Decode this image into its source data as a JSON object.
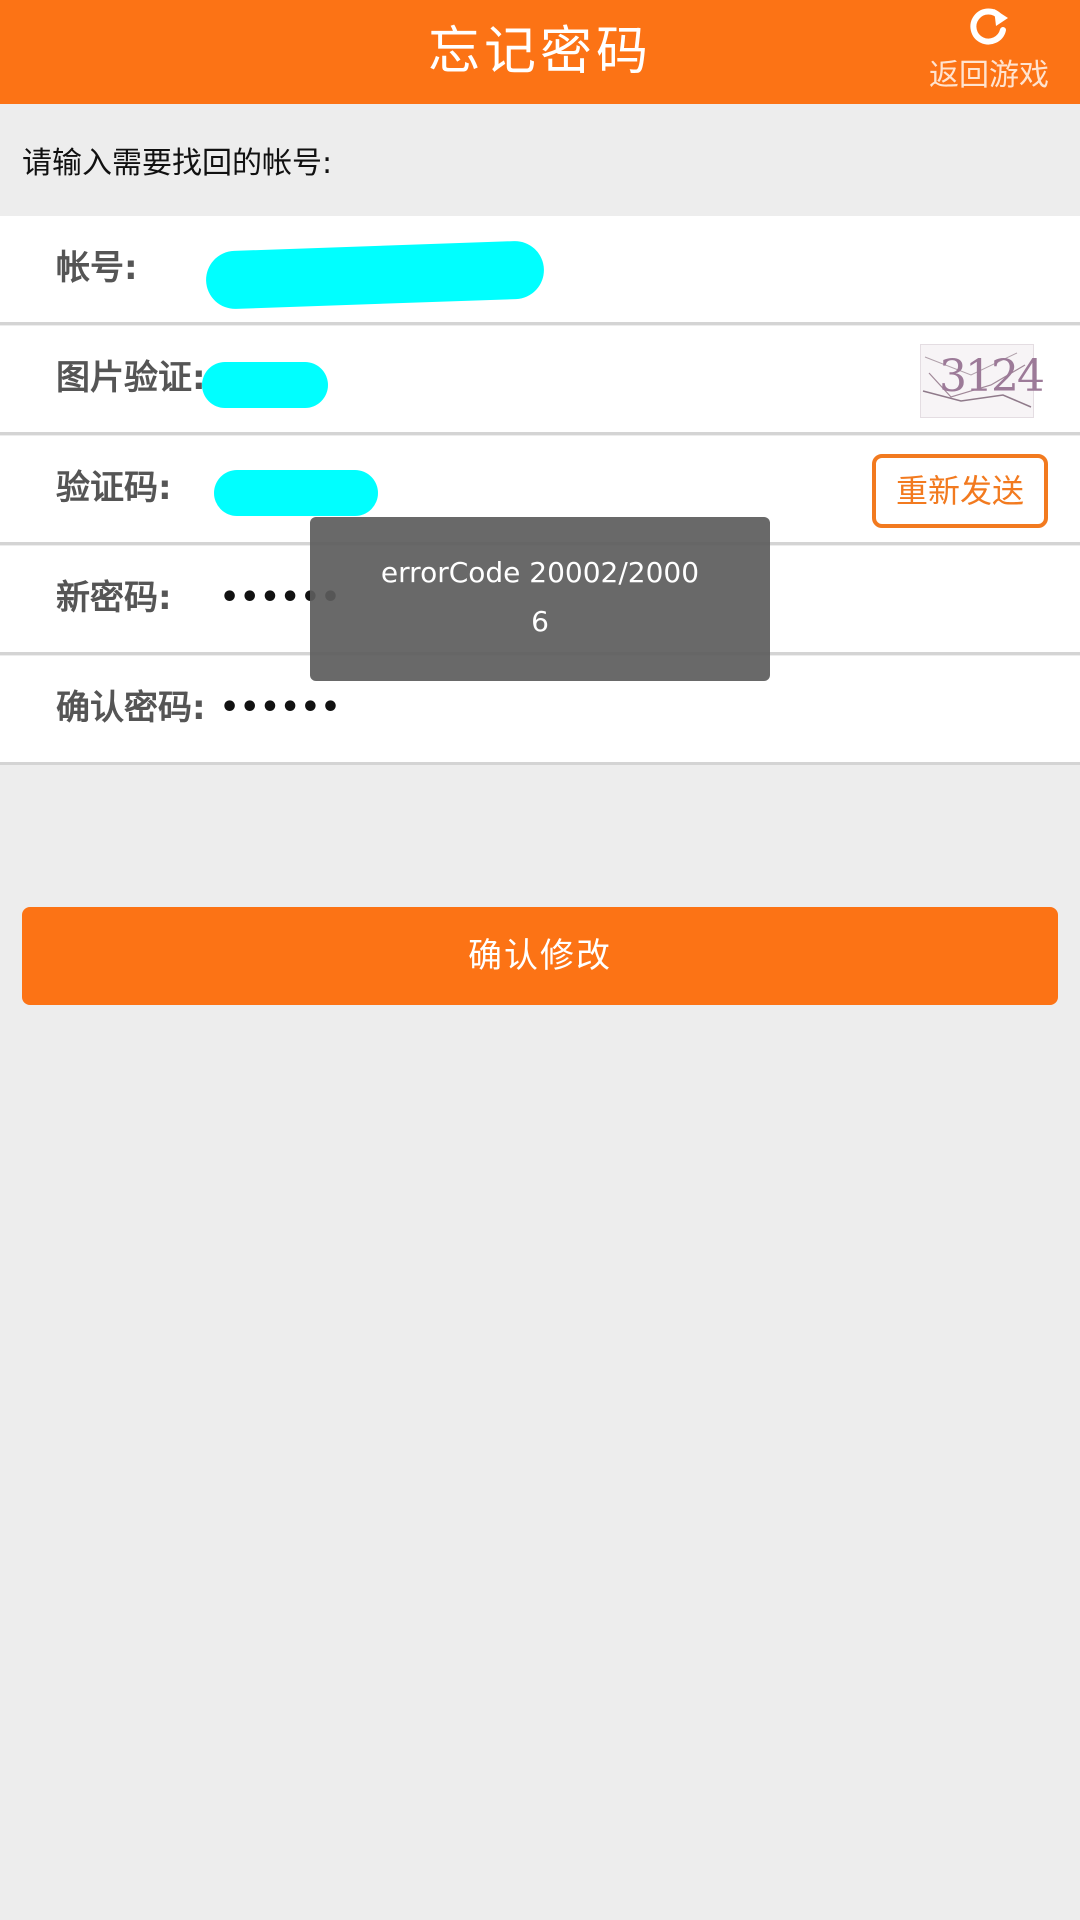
{
  "header": {
    "title": "忘记密码",
    "back_label": "返回游戏",
    "refresh_icon": "refresh-icon",
    "bg_color": "#fc7315"
  },
  "prompt": "请输入需要找回的帐号:",
  "form": {
    "account": {
      "label": "帐号:"
    },
    "image_captcha": {
      "label": "图片验证:",
      "captcha_text": "3124"
    },
    "verify_code": {
      "label": "验证码:",
      "resend_label": "重新发送"
    },
    "new_password": {
      "label": "新密码:",
      "value": "••••••"
    },
    "confirm_password": {
      "label": "确认密码:",
      "value": "••••••"
    }
  },
  "toast": {
    "message": "errorCode 20002/20006"
  },
  "confirm_button": {
    "label": "确认修改"
  }
}
